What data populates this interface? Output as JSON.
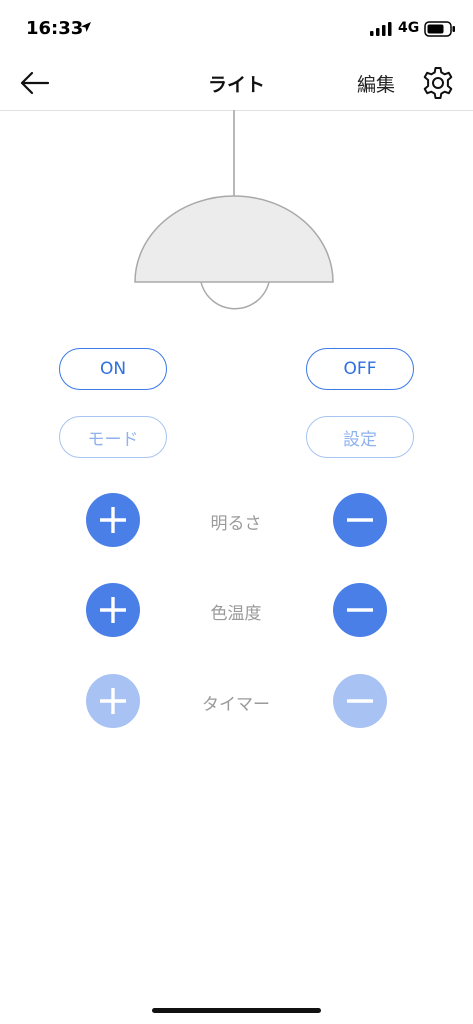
{
  "status": {
    "time": "16:33",
    "network": "4G"
  },
  "nav": {
    "title": "ライト",
    "edit_label": "編集"
  },
  "buttons": {
    "on": "ON",
    "off": "OFF",
    "mode": "モード",
    "setting": "設定"
  },
  "controls": [
    {
      "label": "明るさ",
      "enabled": true
    },
    {
      "label": "色温度",
      "enabled": true
    },
    {
      "label": "タイマー",
      "enabled": false
    }
  ],
  "colors": {
    "accent": "#4a7fe8",
    "accent_disabled": "#a9c2f4",
    "label_gray": "#9a9a9a"
  },
  "icons": {
    "back": "arrow-left-icon",
    "settings": "gear-icon",
    "plus": "plus-icon",
    "minus": "minus-icon",
    "lamp": "pendant-lamp-illustration"
  }
}
